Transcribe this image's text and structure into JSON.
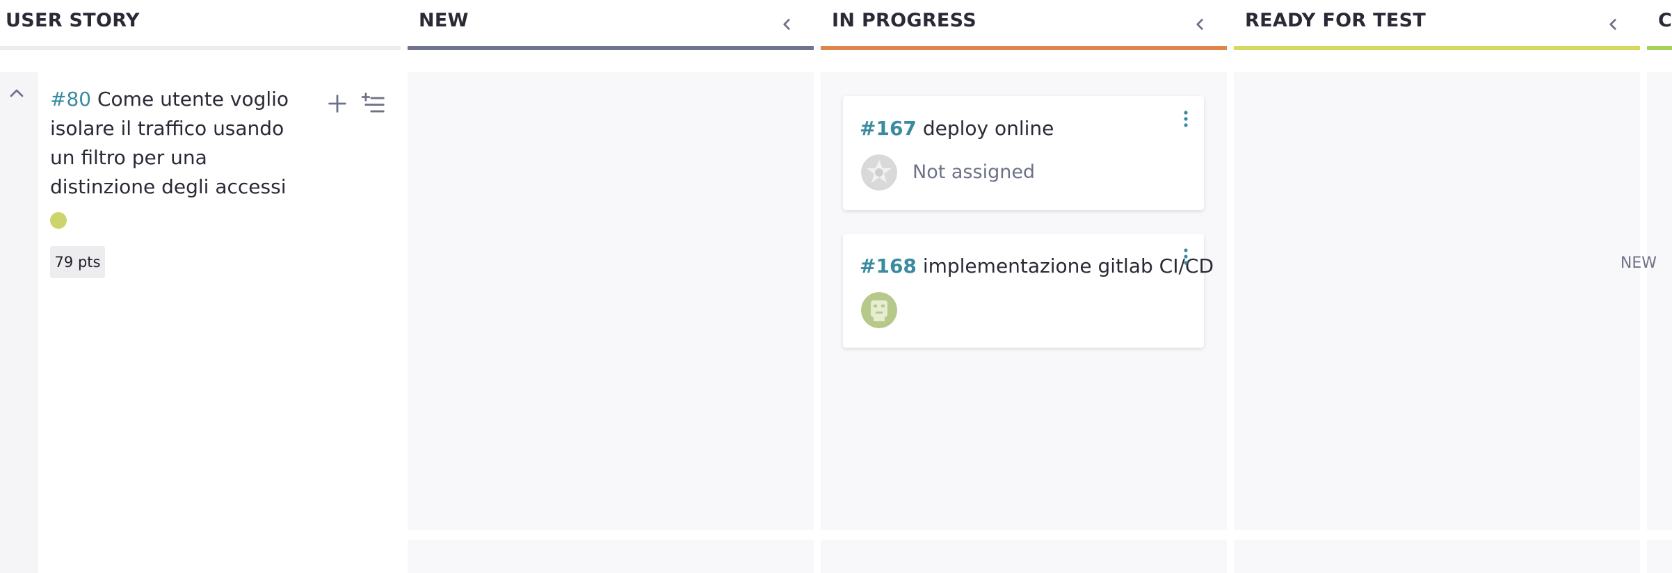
{
  "columns": [
    {
      "id": "user-story",
      "title": "USER STORY",
      "bar_color": "#ececf0"
    },
    {
      "id": "new",
      "title": "NEW",
      "bar_color": "#707390"
    },
    {
      "id": "in-progress",
      "title": "IN PROGRESS",
      "bar_color": "#e0844d"
    },
    {
      "id": "ready-for-test",
      "title": "READY FOR TEST",
      "bar_color": "#d6d95e"
    },
    {
      "id": "closed",
      "title": "C",
      "bar_color": "#a6cf5c"
    }
  ],
  "user_story": {
    "id": "#80",
    "title": " Come utente voglio isolare il traffico usando un filtro per una distinzione degli accessi",
    "dot_color": "#cdd46b",
    "points": "79 pts",
    "status": "NEW"
  },
  "tasks": [
    {
      "id": "#167",
      "title": "deploy online",
      "assignee": "Not assigned"
    },
    {
      "id": "#168",
      "title": "implementazione gitlab CI/CD",
      "assignee": ""
    }
  ],
  "icons": {
    "collapse": "chevron-up-icon",
    "column_fold": "chevron-left-icon",
    "add": "plus-icon",
    "add_tasks": "add-list-icon",
    "card_menu": "kebab-menu-icon"
  }
}
